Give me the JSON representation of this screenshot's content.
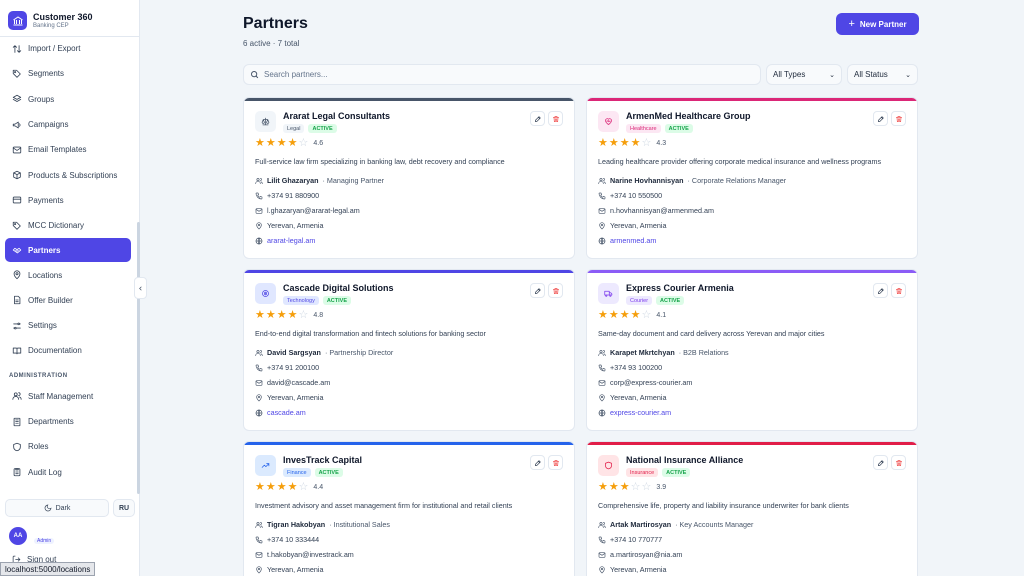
{
  "app": {
    "title": "Customer 360",
    "subtitle": "Banking CEP"
  },
  "sidebar": {
    "items": [
      {
        "label": "Import / Export",
        "icon": "import-export-icon"
      },
      {
        "label": "Segments",
        "icon": "tag-icon"
      },
      {
        "label": "Groups",
        "icon": "layers-icon"
      },
      {
        "label": "Campaigns",
        "icon": "megaphone-icon"
      },
      {
        "label": "Email Templates",
        "icon": "mail-icon"
      },
      {
        "label": "Products & Subscriptions",
        "icon": "package-icon"
      },
      {
        "label": "Payments",
        "icon": "credit-card-icon"
      },
      {
        "label": "MCC Dictionary",
        "icon": "tag-icon"
      },
      {
        "label": "Partners",
        "icon": "handshake-icon",
        "active": true
      },
      {
        "label": "Locations",
        "icon": "map-pin-icon"
      },
      {
        "label": "Offer Builder",
        "icon": "file-icon"
      },
      {
        "label": "Settings",
        "icon": "sliders-icon"
      },
      {
        "label": "Documentation",
        "icon": "book-icon"
      }
    ],
    "admin_section": "ADMINISTRATION",
    "admin_items": [
      {
        "label": "Staff Management",
        "icon": "users-icon"
      },
      {
        "label": "Departments",
        "icon": "building-icon"
      },
      {
        "label": "Roles",
        "icon": "shield-icon"
      },
      {
        "label": "Audit Log",
        "icon": "clipboard-icon"
      }
    ],
    "theme_toggle": "Dark",
    "language": "RU",
    "user_initials": "AA",
    "user_role": "Admin",
    "sign_out": "Sign out"
  },
  "status_bar_url": "localhost:5000/locations",
  "page": {
    "title": "Partners",
    "subtitle": "6 active · 7 total",
    "new_button": "New Partner",
    "search_placeholder": "Search partners...",
    "type_filter": "All Types",
    "status_filter": "All Status"
  },
  "partners": [
    {
      "name": "Ararat Legal Consultants",
      "category": "Legal",
      "status": "ACTIVE",
      "rating": 4.6,
      "stars": 4,
      "description": "Full-service law firm specializing in banking law, debt recovery and compliance",
      "contact": "Lilit Ghazaryan",
      "role": "· Managing Partner",
      "phone": "+374 91 880900",
      "email": "l.ghazaryan@ararat-legal.am",
      "location": "Yerevan, Armenia",
      "website": "ararat-legal.am",
      "accent": "#475569",
      "tag_bg": "#f1f5f9",
      "tag_fg": "#475569",
      "icon": "scale-icon"
    },
    {
      "name": "ArmenMed Healthcare Group",
      "category": "Healthcare",
      "status": "ACTIVE",
      "rating": 4.3,
      "stars": 4,
      "description": "Leading healthcare provider offering corporate medical insurance and wellness programs",
      "contact": "Narine Hovhannisyan",
      "role": "· Corporate Relations Manager",
      "phone": "+374 10 550500",
      "email": "n.hovhannisyan@armenmed.am",
      "location": "Yerevan, Armenia",
      "website": "armenmed.am",
      "accent": "#db2777",
      "tag_bg": "#fce7f3",
      "tag_fg": "#db2777",
      "icon": "heart-pulse-icon"
    },
    {
      "name": "Cascade Digital Solutions",
      "category": "Technology",
      "status": "ACTIVE",
      "rating": 4.8,
      "stars": 4,
      "description": "End-to-end digital transformation and fintech solutions for banking sector",
      "contact": "David Sargsyan",
      "role": "· Partnership Director",
      "phone": "+374 91 200100",
      "email": "david@cascade.am",
      "location": "Yerevan, Armenia",
      "website": "cascade.am",
      "accent": "#4f46e5",
      "tag_bg": "#e0e7ff",
      "tag_fg": "#4f46e5",
      "icon": "cpu-icon"
    },
    {
      "name": "Express Courier Armenia",
      "category": "Courier",
      "status": "ACTIVE",
      "rating": 4.1,
      "stars": 4,
      "description": "Same-day document and card delivery across Yerevan and major cities",
      "contact": "Karapet Mkrtchyan",
      "role": "· B2B Relations",
      "phone": "+374 93 100200",
      "email": "corp@express-courier.am",
      "location": "Yerevan, Armenia",
      "website": "express-courier.am",
      "accent": "#8b5cf6",
      "tag_bg": "#ede9fe",
      "tag_fg": "#7c3aed",
      "icon": "truck-icon"
    },
    {
      "name": "InvesTrack Capital",
      "category": "Finance",
      "status": "ACTIVE",
      "rating": 4.4,
      "stars": 4,
      "description": "Investment advisory and asset management firm for institutional and retail clients",
      "contact": "Tigran Hakobyan",
      "role": "· Institutional Sales",
      "phone": "+374 10 333444",
      "email": "t.hakobyan@investrack.am",
      "location": "Yerevan, Armenia",
      "website": "",
      "accent": "#2563eb",
      "tag_bg": "#dbeafe",
      "tag_fg": "#2563eb",
      "icon": "trending-up-icon"
    },
    {
      "name": "National Insurance Alliance",
      "category": "Insurance",
      "status": "ACTIVE",
      "rating": 3.9,
      "stars": 3,
      "description": "Comprehensive life, property and liability insurance underwriter for bank clients",
      "contact": "Artak Martirosyan",
      "role": "· Key Accounts Manager",
      "phone": "+374 10 770777",
      "email": "a.martirosyan@nia.am",
      "location": "Yerevan, Armenia",
      "website": "",
      "accent": "#e11d48",
      "tag_bg": "#ffe4e6",
      "tag_fg": "#e11d48",
      "icon": "shield-icon"
    }
  ]
}
